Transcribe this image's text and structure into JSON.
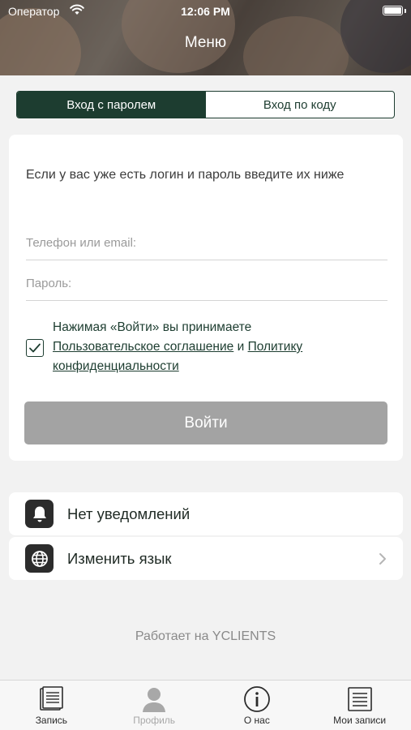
{
  "status_bar": {
    "carrier": "Оператор",
    "time": "12:06 PM"
  },
  "header": {
    "title": "Меню"
  },
  "segment": {
    "password_tab": "Вход с паролем",
    "code_tab": "Вход по коду"
  },
  "login_form": {
    "intro": "Если у вас уже есть логин и пароль введите их ниже",
    "phone_placeholder": "Телефон или email:",
    "password_placeholder": "Пароль:",
    "agreement_prefix": "Нажимая «Войти» вы принимаете",
    "agreement_link": "Пользовательское соглашение",
    "agreement_and": "и",
    "privacy_link_1": "Политику",
    "privacy_link_2": "конфиденциальности",
    "checkbox_checked": true,
    "submit_label": "Войти"
  },
  "menu": {
    "items": [
      {
        "label": "Нет уведомлений",
        "icon": "bell-icon"
      },
      {
        "label": "Изменить язык",
        "icon": "globe-icon"
      }
    ]
  },
  "footer": {
    "powered_by": "Работает на YCLIENTS"
  },
  "tabbar": {
    "tabs": [
      {
        "label": "Запись",
        "icon": "book-icon"
      },
      {
        "label": "Профиль",
        "icon": "profile-icon"
      },
      {
        "label": "О нас",
        "icon": "info-icon"
      },
      {
        "label": "Мои записи",
        "icon": "list-icon"
      }
    ]
  },
  "colors": {
    "accent": "#1d3d30",
    "button_disabled": "#a3a3a3",
    "background": "#f2f2f2"
  }
}
